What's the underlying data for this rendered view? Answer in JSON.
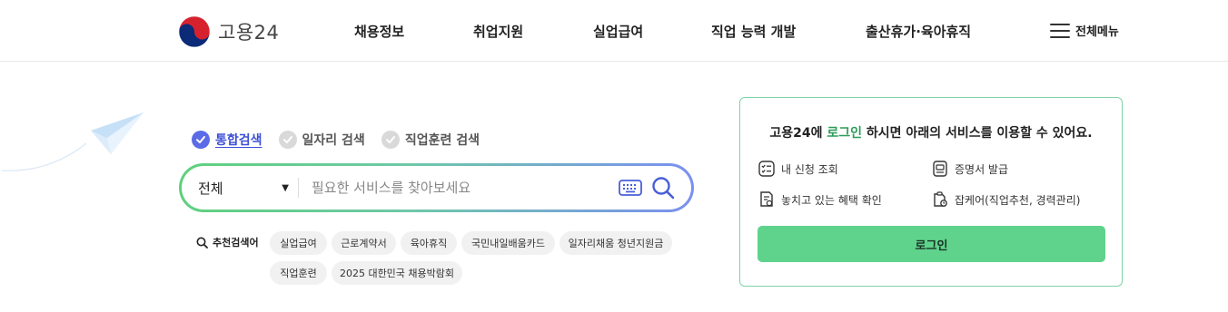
{
  "header": {
    "logo_text": "고용24",
    "nav": [
      "채용정보",
      "취업지원",
      "실업급여",
      "직업 능력 개발",
      "출산휴가·육아휴직"
    ],
    "all_menu_label": "전체메뉴"
  },
  "search": {
    "tabs": [
      {
        "label": "통합검색",
        "active": true
      },
      {
        "label": "일자리 검색",
        "active": false
      },
      {
        "label": "직업훈련 검색",
        "active": false
      }
    ],
    "scope_value": "전체",
    "placeholder": "필요한 서비스를 찾아보세요"
  },
  "recommended": {
    "label": "추천검색어",
    "keywords": [
      "실업급여",
      "근로계약서",
      "육아휴직",
      "국민내일배움카드",
      "일자리채움 청년지원금",
      "직업훈련",
      "2025 대한민국 채용박람회"
    ]
  },
  "login_card": {
    "message_prefix": "고용24에 ",
    "message_highlight": "로그인",
    "message_suffix": " 하시면 아래의 서비스를 이용할 수 있어요.",
    "services": [
      "내 신청 조회",
      "증명서 발급",
      "놓치고 있는 혜택 확인",
      "잡케어(직업추천, 경력관리)"
    ],
    "login_button": "로그인"
  },
  "colors": {
    "accent_blue": "#3d4fd6",
    "accent_green": "#2e9c5a",
    "login_button": "#5fd38c",
    "card_border": "#7fd3a6"
  },
  "icons": [
    "taegeuk-logo-icon",
    "hamburger-icon",
    "check-icon",
    "keyboard-icon",
    "search-icon",
    "list-check-icon",
    "certificate-icon",
    "benefit-doc-icon",
    "jobcare-icon",
    "paper-plane-icon"
  ]
}
